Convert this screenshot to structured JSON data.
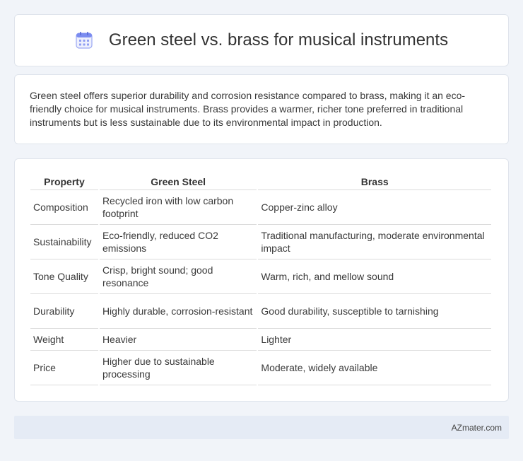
{
  "header": {
    "title": "Green steel vs. brass for musical instruments",
    "icon": "calendar-icon"
  },
  "summary": {
    "text": "Green steel offers superior durability and corrosion resistance compared to brass, making it an eco-friendly choice for musical instruments. Brass provides a warmer, richer tone preferred in traditional instruments but is less sustainable due to its environmental impact in production."
  },
  "table": {
    "headers": [
      "Property",
      "Green Steel",
      "Brass"
    ],
    "rows": [
      [
        "Composition",
        "Recycled iron with low carbon footprint",
        "Copper-zinc alloy"
      ],
      [
        "Sustainability",
        "Eco-friendly, reduced CO2 emissions",
        "Traditional manufacturing, moderate environmental impact"
      ],
      [
        "Tone Quality",
        "Crisp, bright sound; good resonance",
        "Warm, rich, and mellow sound"
      ],
      [
        "Durability",
        "Highly durable, corrosion-resistant",
        "Good durability, susceptible to tarnishing"
      ],
      [
        "Weight",
        "Heavier",
        "Lighter"
      ],
      [
        "Price",
        "Higher due to sustainable processing",
        "Moderate, widely available"
      ]
    ]
  },
  "footer": {
    "text": "AZmater.com"
  },
  "colors": {
    "background": "#f1f4f9",
    "icon_accent": "#7b8cf0"
  }
}
